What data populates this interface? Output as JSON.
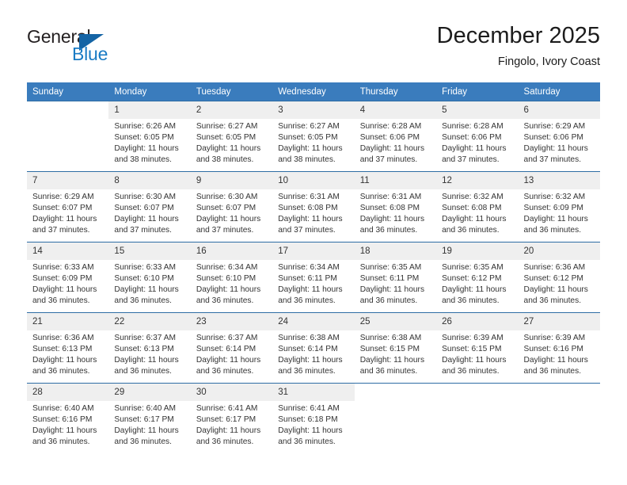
{
  "brand": {
    "name_top": "General",
    "name_bottom": "Blue",
    "accent_color": "#1a7bc4",
    "triangle_color": "#1464a5"
  },
  "header": {
    "title": "December 2025",
    "subtitle": "Fingolo, Ivory Coast"
  },
  "calendar": {
    "header_color": "#3a7cbd",
    "weekday_headers": [
      "Sunday",
      "Monday",
      "Tuesday",
      "Wednesday",
      "Thursday",
      "Friday",
      "Saturday"
    ],
    "weeks": [
      [
        {
          "day": "",
          "sunrise": "",
          "sunset": "",
          "daylight_line1": "",
          "daylight_line2": ""
        },
        {
          "day": "1",
          "sunrise": "Sunrise: 6:26 AM",
          "sunset": "Sunset: 6:05 PM",
          "daylight_line1": "Daylight: 11 hours",
          "daylight_line2": "and 38 minutes."
        },
        {
          "day": "2",
          "sunrise": "Sunrise: 6:27 AM",
          "sunset": "Sunset: 6:05 PM",
          "daylight_line1": "Daylight: 11 hours",
          "daylight_line2": "and 38 minutes."
        },
        {
          "day": "3",
          "sunrise": "Sunrise: 6:27 AM",
          "sunset": "Sunset: 6:05 PM",
          "daylight_line1": "Daylight: 11 hours",
          "daylight_line2": "and 38 minutes."
        },
        {
          "day": "4",
          "sunrise": "Sunrise: 6:28 AM",
          "sunset": "Sunset: 6:06 PM",
          "daylight_line1": "Daylight: 11 hours",
          "daylight_line2": "and 37 minutes."
        },
        {
          "day": "5",
          "sunrise": "Sunrise: 6:28 AM",
          "sunset": "Sunset: 6:06 PM",
          "daylight_line1": "Daylight: 11 hours",
          "daylight_line2": "and 37 minutes."
        },
        {
          "day": "6",
          "sunrise": "Sunrise: 6:29 AM",
          "sunset": "Sunset: 6:06 PM",
          "daylight_line1": "Daylight: 11 hours",
          "daylight_line2": "and 37 minutes."
        }
      ],
      [
        {
          "day": "7",
          "sunrise": "Sunrise: 6:29 AM",
          "sunset": "Sunset: 6:07 PM",
          "daylight_line1": "Daylight: 11 hours",
          "daylight_line2": "and 37 minutes."
        },
        {
          "day": "8",
          "sunrise": "Sunrise: 6:30 AM",
          "sunset": "Sunset: 6:07 PM",
          "daylight_line1": "Daylight: 11 hours",
          "daylight_line2": "and 37 minutes."
        },
        {
          "day": "9",
          "sunrise": "Sunrise: 6:30 AM",
          "sunset": "Sunset: 6:07 PM",
          "daylight_line1": "Daylight: 11 hours",
          "daylight_line2": "and 37 minutes."
        },
        {
          "day": "10",
          "sunrise": "Sunrise: 6:31 AM",
          "sunset": "Sunset: 6:08 PM",
          "daylight_line1": "Daylight: 11 hours",
          "daylight_line2": "and 37 minutes."
        },
        {
          "day": "11",
          "sunrise": "Sunrise: 6:31 AM",
          "sunset": "Sunset: 6:08 PM",
          "daylight_line1": "Daylight: 11 hours",
          "daylight_line2": "and 36 minutes."
        },
        {
          "day": "12",
          "sunrise": "Sunrise: 6:32 AM",
          "sunset": "Sunset: 6:08 PM",
          "daylight_line1": "Daylight: 11 hours",
          "daylight_line2": "and 36 minutes."
        },
        {
          "day": "13",
          "sunrise": "Sunrise: 6:32 AM",
          "sunset": "Sunset: 6:09 PM",
          "daylight_line1": "Daylight: 11 hours",
          "daylight_line2": "and 36 minutes."
        }
      ],
      [
        {
          "day": "14",
          "sunrise": "Sunrise: 6:33 AM",
          "sunset": "Sunset: 6:09 PM",
          "daylight_line1": "Daylight: 11 hours",
          "daylight_line2": "and 36 minutes."
        },
        {
          "day": "15",
          "sunrise": "Sunrise: 6:33 AM",
          "sunset": "Sunset: 6:10 PM",
          "daylight_line1": "Daylight: 11 hours",
          "daylight_line2": "and 36 minutes."
        },
        {
          "day": "16",
          "sunrise": "Sunrise: 6:34 AM",
          "sunset": "Sunset: 6:10 PM",
          "daylight_line1": "Daylight: 11 hours",
          "daylight_line2": "and 36 minutes."
        },
        {
          "day": "17",
          "sunrise": "Sunrise: 6:34 AM",
          "sunset": "Sunset: 6:11 PM",
          "daylight_line1": "Daylight: 11 hours",
          "daylight_line2": "and 36 minutes."
        },
        {
          "day": "18",
          "sunrise": "Sunrise: 6:35 AM",
          "sunset": "Sunset: 6:11 PM",
          "daylight_line1": "Daylight: 11 hours",
          "daylight_line2": "and 36 minutes."
        },
        {
          "day": "19",
          "sunrise": "Sunrise: 6:35 AM",
          "sunset": "Sunset: 6:12 PM",
          "daylight_line1": "Daylight: 11 hours",
          "daylight_line2": "and 36 minutes."
        },
        {
          "day": "20",
          "sunrise": "Sunrise: 6:36 AM",
          "sunset": "Sunset: 6:12 PM",
          "daylight_line1": "Daylight: 11 hours",
          "daylight_line2": "and 36 minutes."
        }
      ],
      [
        {
          "day": "21",
          "sunrise": "Sunrise: 6:36 AM",
          "sunset": "Sunset: 6:13 PM",
          "daylight_line1": "Daylight: 11 hours",
          "daylight_line2": "and 36 minutes."
        },
        {
          "day": "22",
          "sunrise": "Sunrise: 6:37 AM",
          "sunset": "Sunset: 6:13 PM",
          "daylight_line1": "Daylight: 11 hours",
          "daylight_line2": "and 36 minutes."
        },
        {
          "day": "23",
          "sunrise": "Sunrise: 6:37 AM",
          "sunset": "Sunset: 6:14 PM",
          "daylight_line1": "Daylight: 11 hours",
          "daylight_line2": "and 36 minutes."
        },
        {
          "day": "24",
          "sunrise": "Sunrise: 6:38 AM",
          "sunset": "Sunset: 6:14 PM",
          "daylight_line1": "Daylight: 11 hours",
          "daylight_line2": "and 36 minutes."
        },
        {
          "day": "25",
          "sunrise": "Sunrise: 6:38 AM",
          "sunset": "Sunset: 6:15 PM",
          "daylight_line1": "Daylight: 11 hours",
          "daylight_line2": "and 36 minutes."
        },
        {
          "day": "26",
          "sunrise": "Sunrise: 6:39 AM",
          "sunset": "Sunset: 6:15 PM",
          "daylight_line1": "Daylight: 11 hours",
          "daylight_line2": "and 36 minutes."
        },
        {
          "day": "27",
          "sunrise": "Sunrise: 6:39 AM",
          "sunset": "Sunset: 6:16 PM",
          "daylight_line1": "Daylight: 11 hours",
          "daylight_line2": "and 36 minutes."
        }
      ],
      [
        {
          "day": "28",
          "sunrise": "Sunrise: 6:40 AM",
          "sunset": "Sunset: 6:16 PM",
          "daylight_line1": "Daylight: 11 hours",
          "daylight_line2": "and 36 minutes."
        },
        {
          "day": "29",
          "sunrise": "Sunrise: 6:40 AM",
          "sunset": "Sunset: 6:17 PM",
          "daylight_line1": "Daylight: 11 hours",
          "daylight_line2": "and 36 minutes."
        },
        {
          "day": "30",
          "sunrise": "Sunrise: 6:41 AM",
          "sunset": "Sunset: 6:17 PM",
          "daylight_line1": "Daylight: 11 hours",
          "daylight_line2": "and 36 minutes."
        },
        {
          "day": "31",
          "sunrise": "Sunrise: 6:41 AM",
          "sunset": "Sunset: 6:18 PM",
          "daylight_line1": "Daylight: 11 hours",
          "daylight_line2": "and 36 minutes."
        },
        {
          "day": "",
          "sunrise": "",
          "sunset": "",
          "daylight_line1": "",
          "daylight_line2": ""
        },
        {
          "day": "",
          "sunrise": "",
          "sunset": "",
          "daylight_line1": "",
          "daylight_line2": ""
        },
        {
          "day": "",
          "sunrise": "",
          "sunset": "",
          "daylight_line1": "",
          "daylight_line2": ""
        }
      ]
    ]
  }
}
